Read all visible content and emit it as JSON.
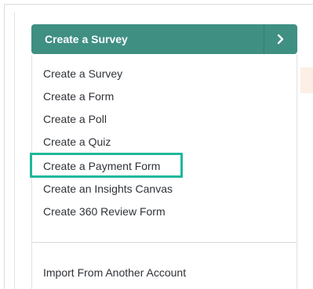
{
  "create_button": {
    "label": "Create a Survey",
    "color": "#3f8f83"
  },
  "menu": {
    "items": [
      {
        "label": "Create a Survey"
      },
      {
        "label": "Create a Form"
      },
      {
        "label": "Create a Poll"
      },
      {
        "label": "Create a Quiz"
      },
      {
        "label": "Create a Payment Form"
      },
      {
        "label": "Create an Insights Canvas"
      },
      {
        "label": "Create 360 Review Form"
      }
    ],
    "import_label": "Import From Another Account",
    "highlighted_item": "Create a Payment Form",
    "highlight_color": "#1fb79b"
  },
  "icons": {
    "arrow": "chevron-right-icon"
  }
}
